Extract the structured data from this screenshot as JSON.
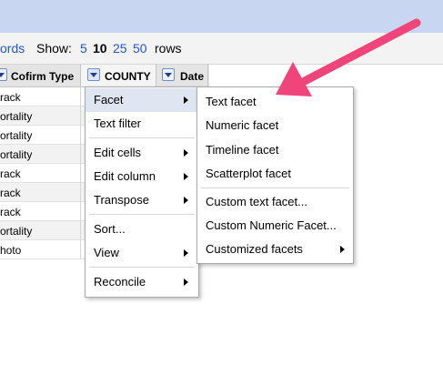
{
  "toolbar": {
    "records_text": "ords",
    "show_label": "Show:",
    "page_sizes": [
      "5",
      "10",
      "25",
      "50"
    ],
    "selected_page_size": "10",
    "rows_label": "rows"
  },
  "columns": [
    {
      "label": "Cofirm Type"
    },
    {
      "label": "COUNTY"
    },
    {
      "label": "Date"
    }
  ],
  "rows": [
    "rack",
    "ortality",
    "ortality",
    "ortality",
    "rack",
    "rack",
    "rack",
    "ortality",
    "hoto"
  ],
  "column_menu": {
    "items": [
      {
        "label": "Facet",
        "submenu": true
      },
      {
        "label": "Text filter",
        "submenu": false
      },
      {
        "label": "Edit cells",
        "submenu": true
      },
      {
        "label": "Edit column",
        "submenu": true
      },
      {
        "label": "Transpose",
        "submenu": true
      },
      {
        "label": "Sort...",
        "submenu": false
      },
      {
        "label": "View",
        "submenu": true
      },
      {
        "label": "Reconcile",
        "submenu": true
      }
    ]
  },
  "facet_menu": {
    "items": [
      {
        "label": "Text facet",
        "submenu": false
      },
      {
        "label": "Numeric facet",
        "submenu": false
      },
      {
        "label": "Timeline facet",
        "submenu": false
      },
      {
        "label": "Scatterplot facet",
        "submenu": false
      },
      {
        "label": "Custom text facet...",
        "submenu": false
      },
      {
        "label": "Custom Numeric Facet...",
        "submenu": false
      },
      {
        "label": "Customized facets",
        "submenu": true
      }
    ]
  },
  "colors": {
    "top_bar": "#c9d6f2",
    "link": "#2255cc",
    "menu_highlight": "#dfe5f1",
    "callout_arrow": "#f0457a"
  }
}
